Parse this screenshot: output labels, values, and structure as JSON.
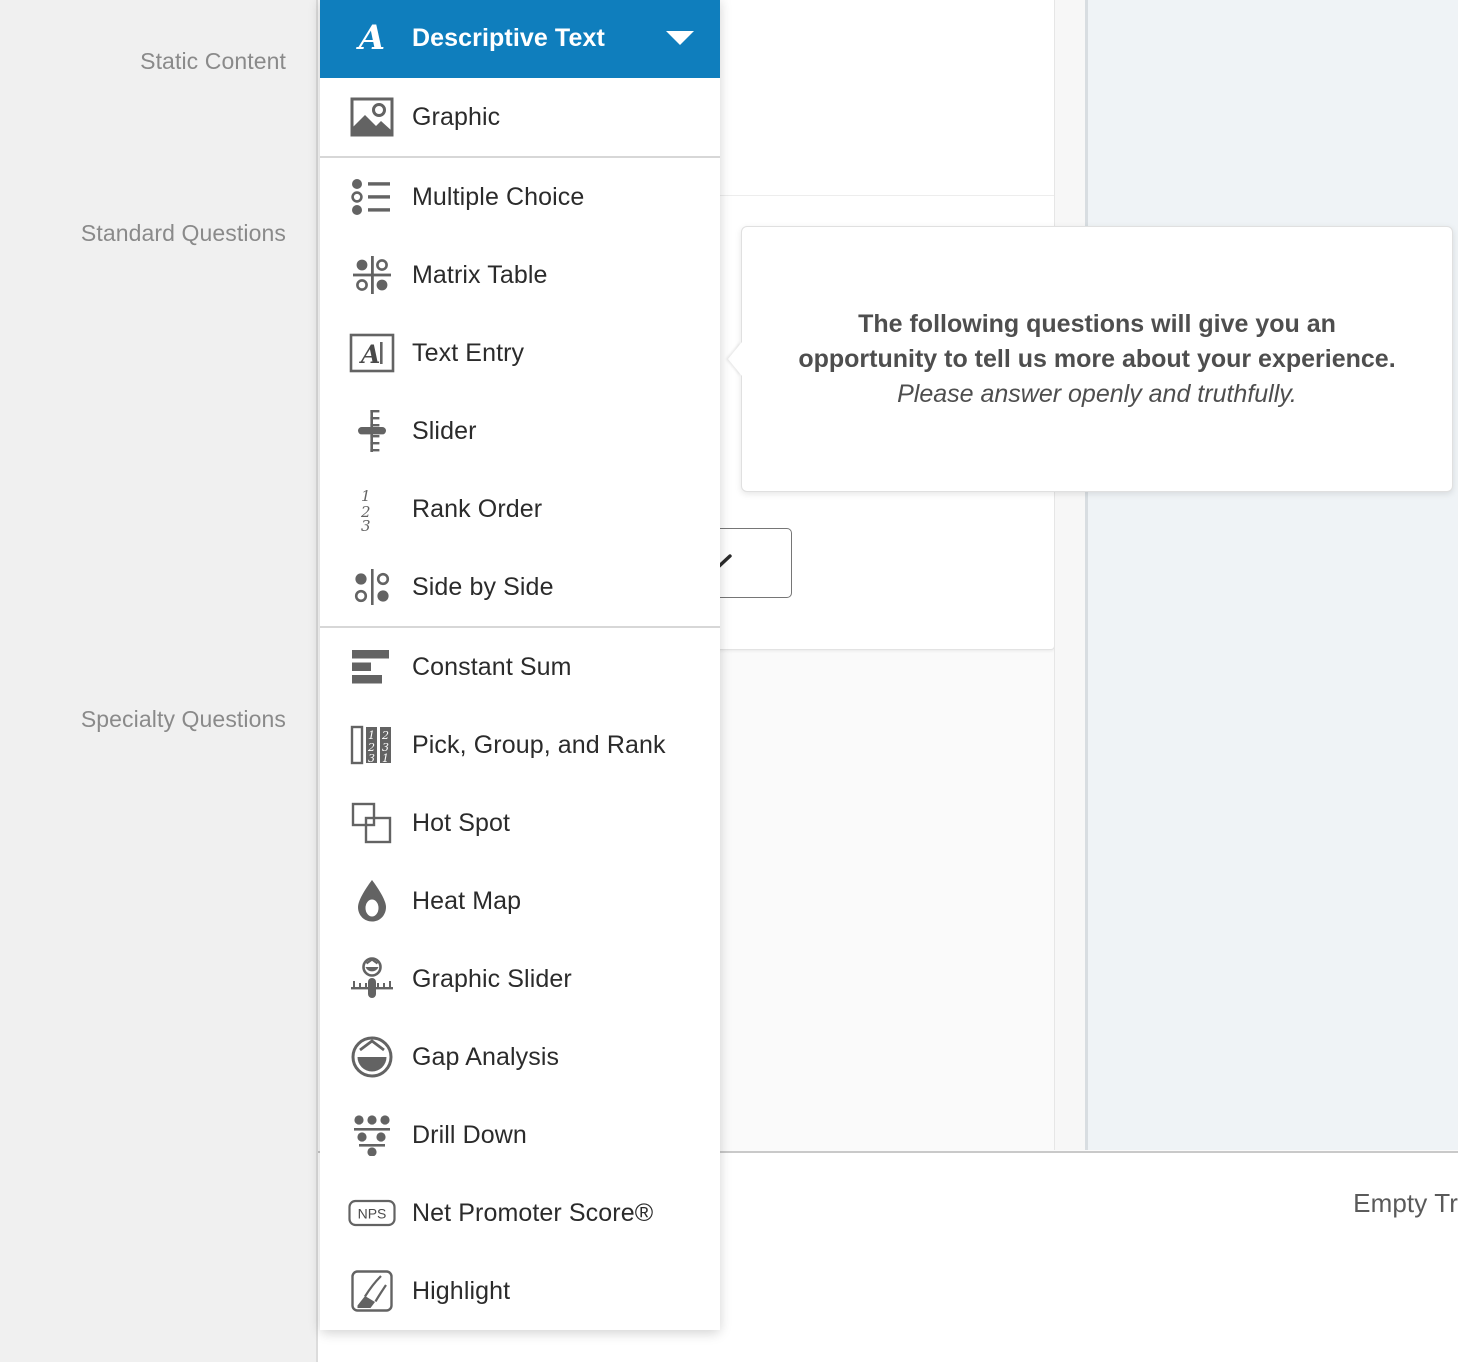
{
  "sidebar": {
    "groups": [
      {
        "label": "Static Content"
      },
      {
        "label": "Standard Questions"
      },
      {
        "label": "Specialty Questions"
      }
    ]
  },
  "menu": {
    "header": {
      "label": "Descriptive Text",
      "icon": "serif-a-icon",
      "caret": "caret-down-icon",
      "background_color": "#0f7ebd",
      "text_color": "#ffffff"
    },
    "groups": [
      {
        "name": "static-content",
        "items": [
          {
            "label": "Graphic",
            "icon": "image-icon"
          }
        ]
      },
      {
        "name": "standard-questions",
        "items": [
          {
            "label": "Multiple Choice",
            "icon": "multiple-choice-icon"
          },
          {
            "label": "Matrix Table",
            "icon": "matrix-table-icon"
          },
          {
            "label": "Text Entry",
            "icon": "text-entry-icon"
          },
          {
            "label": "Slider",
            "icon": "slider-icon"
          },
          {
            "label": "Rank Order",
            "icon": "rank-order-icon"
          },
          {
            "label": "Side by Side",
            "icon": "side-by-side-icon"
          }
        ]
      },
      {
        "name": "specialty-questions",
        "items": [
          {
            "label": "Constant Sum",
            "icon": "constant-sum-icon"
          },
          {
            "label": "Pick, Group, and Rank",
            "icon": "pick-group-rank-icon"
          },
          {
            "label": "Hot Spot",
            "icon": "hot-spot-icon"
          },
          {
            "label": "Heat Map",
            "icon": "heat-map-icon"
          },
          {
            "label": "Graphic Slider",
            "icon": "graphic-slider-icon"
          },
          {
            "label": "Gap Analysis",
            "icon": "gap-analysis-icon"
          },
          {
            "label": "Drill Down",
            "icon": "drill-down-icon"
          },
          {
            "label": "Net Promoter Score®",
            "icon": "nps-icon"
          },
          {
            "label": "Highlight",
            "icon": "highlight-icon"
          }
        ]
      }
    ]
  },
  "callout": {
    "bold_line": "The following questions will give you an opportunity to tell us more about your experience.",
    "italic_line": "Please answer openly and truthfully."
  },
  "editor": {
    "dropdown_icon": "chevron-down-icon"
  },
  "footer": {
    "empty_trash_label": "Empty Tr"
  },
  "colors": {
    "accent_blue": "#0f7ebd",
    "rail_background": "#f0f0f0",
    "panel_background": "#eff3f6",
    "icon_gray": "#636363",
    "label_gray": "#8a8a8a"
  }
}
